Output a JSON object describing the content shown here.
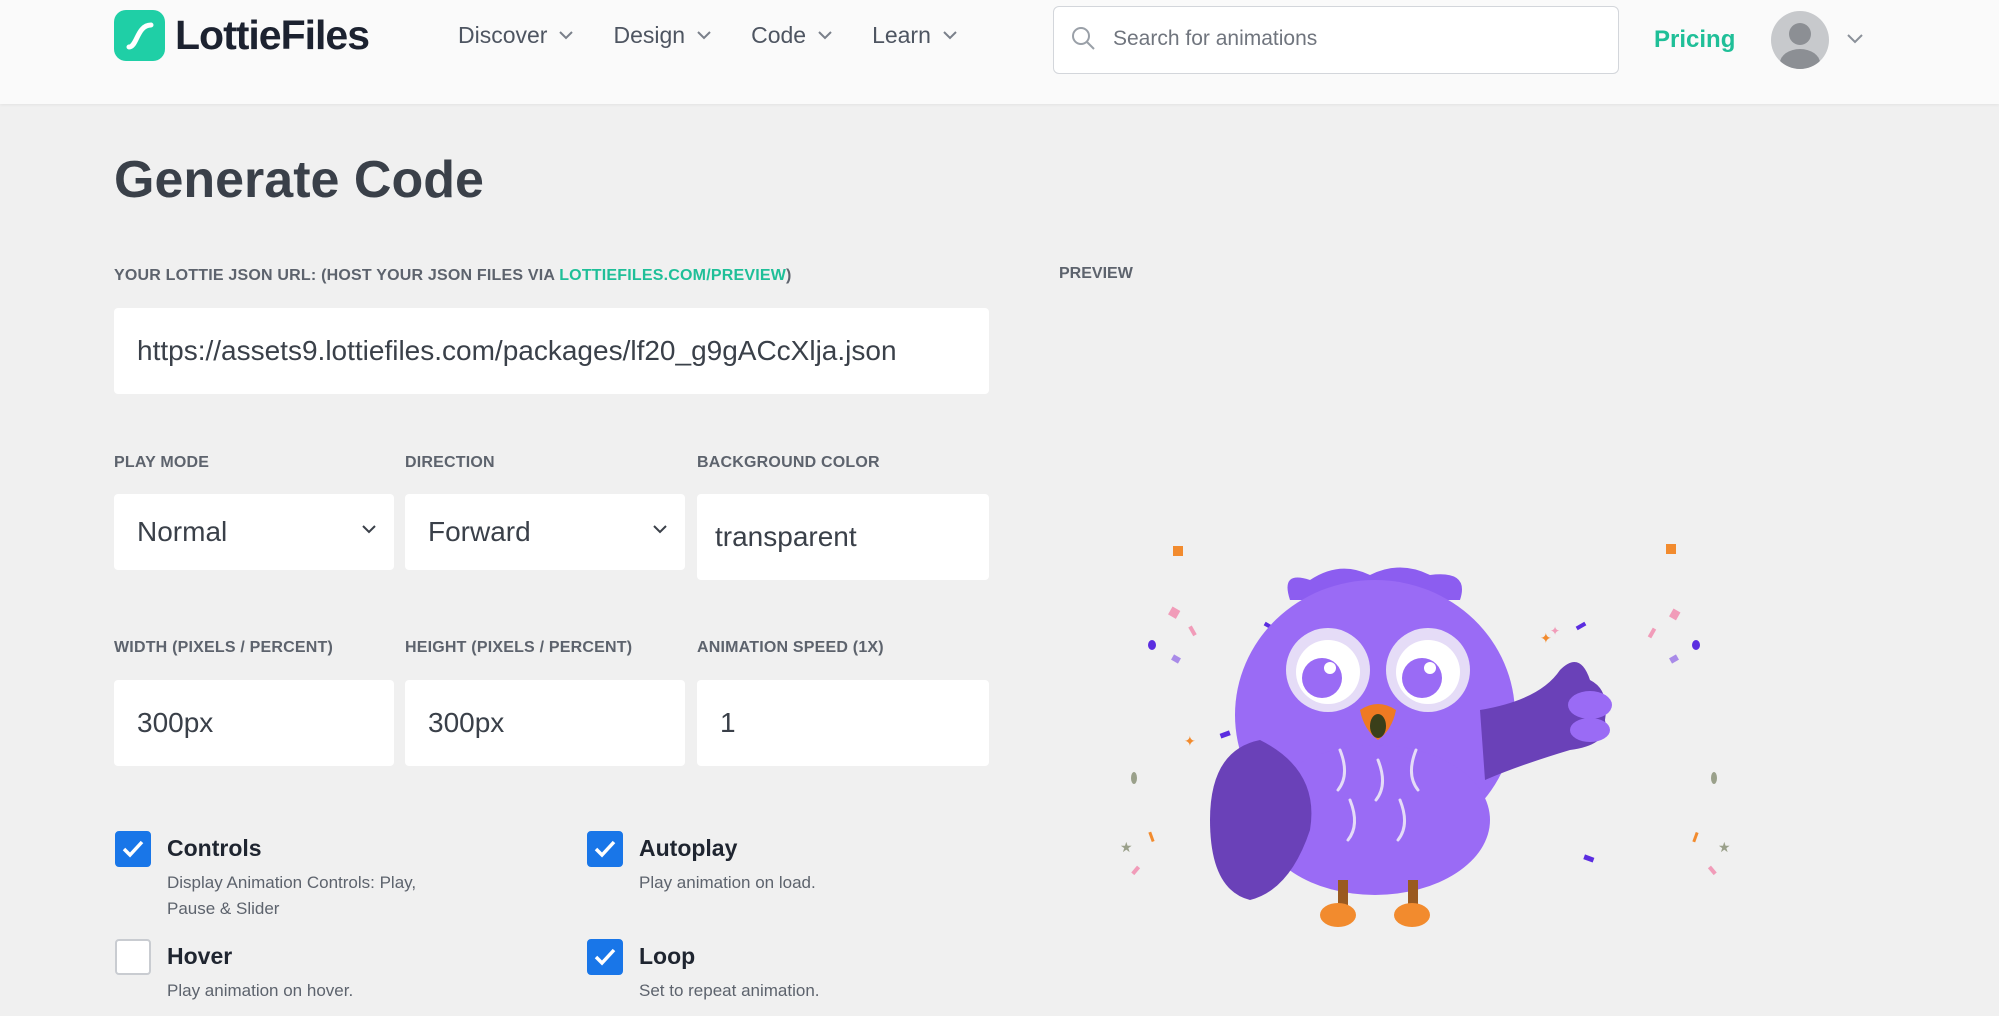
{
  "brand": {
    "name": "LottieFiles",
    "accent": "#1fcfa6",
    "link_color": "#1fbf98",
    "checkbox_color": "#1976e8"
  },
  "nav": [
    {
      "label": "Discover"
    },
    {
      "label": "Design"
    },
    {
      "label": "Code"
    },
    {
      "label": "Learn"
    }
  ],
  "search": {
    "placeholder": "Search for animations",
    "icon": "search-icon"
  },
  "pricing": "Pricing",
  "page": {
    "title": "Generate Code",
    "json_url_label_prefix": "YOUR LOTTIE JSON URL: (HOST YOUR JSON FILES VIA ",
    "json_url_label_link": "LOTTIEFILES.COM/PREVIEW",
    "json_url_label_suffix": ")",
    "json_url_value": "https://assets9.lottiefiles.com/packages/lf20_g9gACcXlja.json",
    "play_mode": {
      "label": "PLAY MODE",
      "value": "Normal"
    },
    "direction": {
      "label": "DIRECTION",
      "value": "Forward"
    },
    "background_color": {
      "label": "BACKGROUND COLOR",
      "value": "transparent"
    },
    "width": {
      "label": "WIDTH (PIXELS / PERCENT)",
      "value": "300px"
    },
    "height": {
      "label": "HEIGHT (PIXELS / PERCENT)",
      "value": "300px"
    },
    "speed": {
      "label": "ANIMATION SPEED (1X)",
      "value": "1"
    },
    "options": {
      "controls": {
        "title": "Controls",
        "desc": "Display Animation Controls: Play, Pause & Slider",
        "checked": true
      },
      "autoplay": {
        "title": "Autoplay",
        "desc": "Play animation on load.",
        "checked": true
      },
      "hover": {
        "title": "Hover",
        "desc": "Play animation on hover.",
        "checked": false
      },
      "loop": {
        "title": "Loop",
        "desc": "Set to repeat animation.",
        "checked": true
      }
    },
    "preview_label": "PREVIEW"
  }
}
